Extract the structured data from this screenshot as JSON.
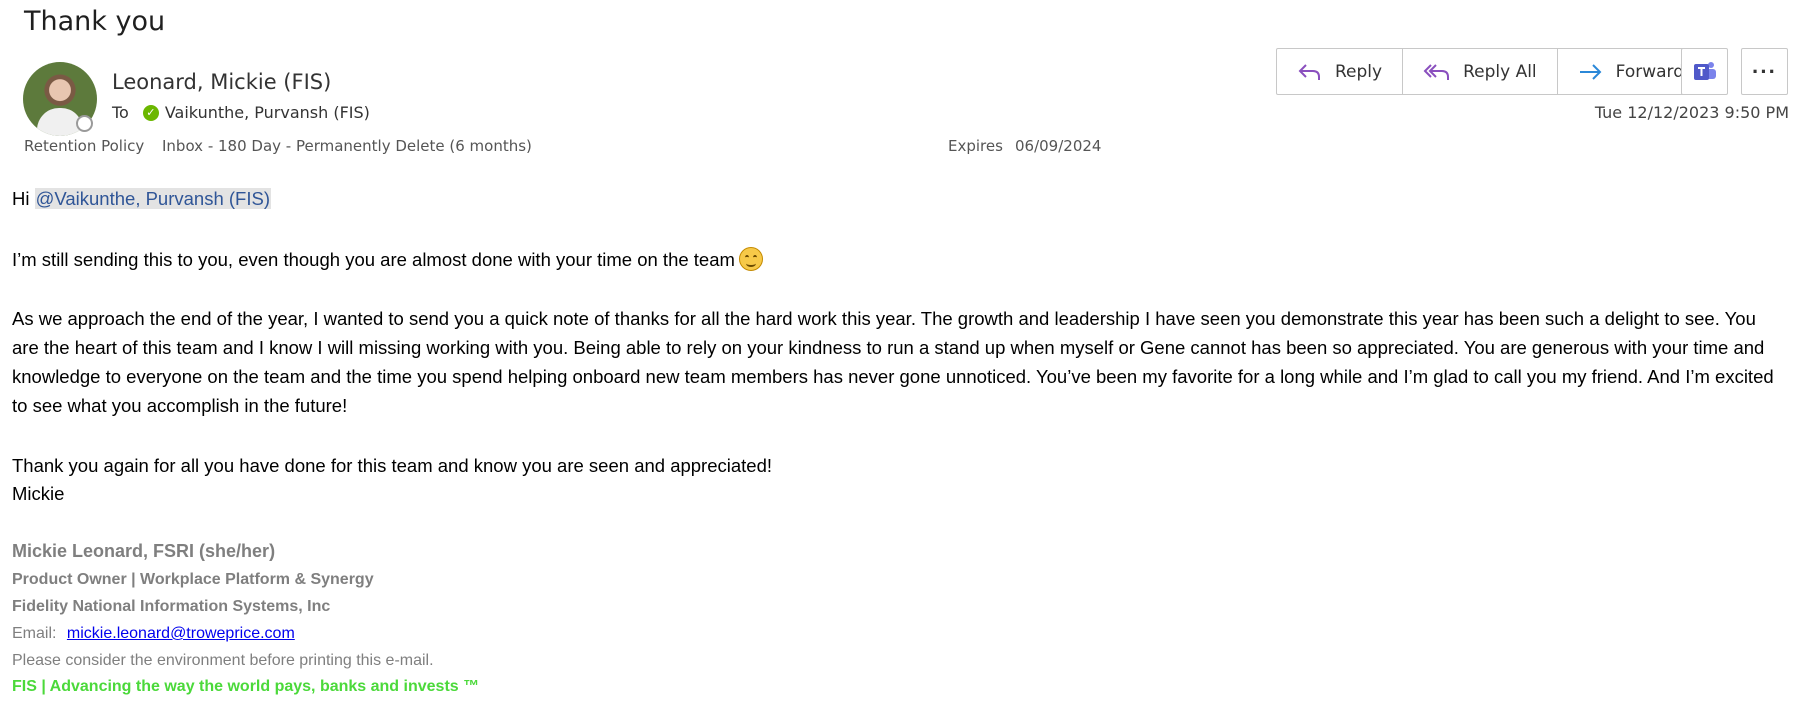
{
  "email": {
    "subject": "Thank you",
    "sender": "Leonard, Mickie (FIS)",
    "to_label": "To",
    "recipient": "Vaikunthe, Purvansh (FIS)",
    "date": "Tue 12/12/2023 9:50 PM",
    "retention_label": "Retention Policy",
    "retention_value": "Inbox - 180 Day - Permanently Delete (6 months)",
    "expires_label": "Expires",
    "expires_value": "06/09/2024"
  },
  "toolbar": {
    "reply_label": "Reply",
    "reply_all_label": "Reply All",
    "forward_label": "Forward",
    "more_label": "···"
  },
  "body": {
    "greeting_prefix": "Hi",
    "mention": "@Vaikunthe, Purvansh (FIS)",
    "line1": "I’m still sending this to you, even though you are almost done with your time on the team",
    "paragraph": "As we approach the end of the year, I wanted to send you a quick note of thanks for all the hard work this year. The growth and leadership I have seen you demonstrate this year has been such a delight to see. You are the heart of this team and I know I will missing working with you. Being able to rely on your kindness to run a stand up when myself or Gene cannot has been so appreciated. You are generous with your time and knowledge to everyone on the team and the time you spend helping onboard new team members has never gone unnoticed. You’ve been my favorite for a long while and I’m glad to call you my friend. And I’m excited to see what you accomplish in the future!",
    "closing": "Thank you again for all you have done for this team and know you are seen and appreciated!",
    "sign_off": "Mickie"
  },
  "signature": {
    "name": "Mickie Leonard, FSRI (she/her)",
    "title": "Product Owner | Workplace Platform & Synergy",
    "company": "Fidelity National Information Systems, Inc",
    "email_label": "Email:",
    "email": "mickie.leonard@troweprice.com",
    "environment_note": "Please consider the environment before printing this e-mail.",
    "tagline": "FIS | Advancing the way the world pays, banks and invests ™"
  },
  "icons": {
    "reply": "reply-icon",
    "reply_all": "reply-all-icon",
    "forward": "forward-icon",
    "teams": "teams-icon",
    "presence_ok": "check-circle-icon"
  },
  "colors": {
    "reply_purple": "#8a4fbe",
    "forward_blue": "#2b88d8",
    "teams": "#5059c9",
    "mention_text": "#2f5597",
    "link": "#0000ee",
    "tagline_green": "#4bd93a",
    "presence_green": "#6bb700"
  }
}
